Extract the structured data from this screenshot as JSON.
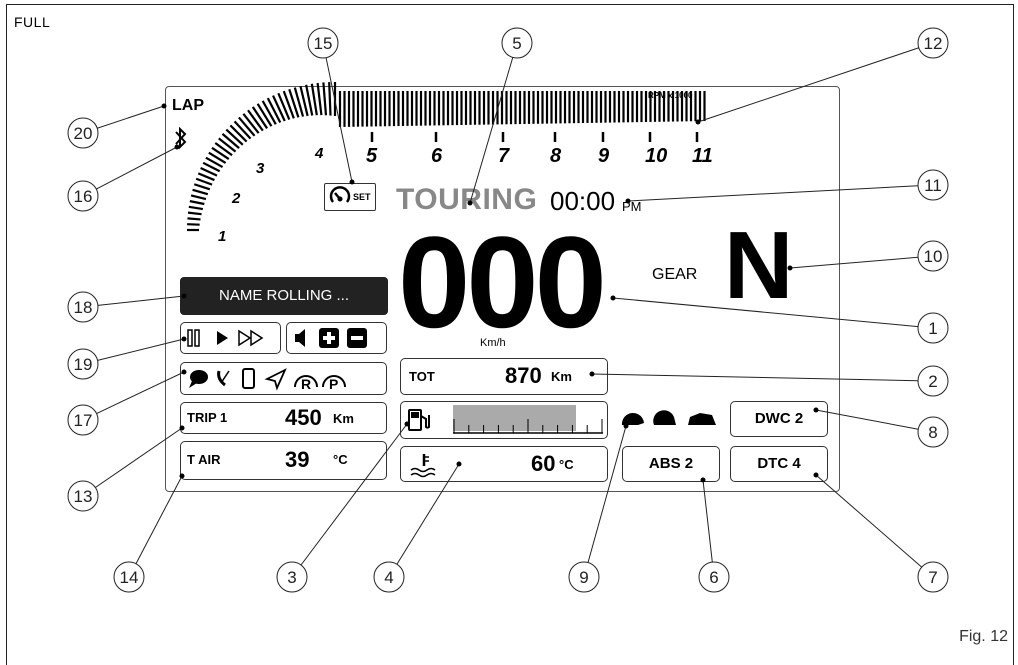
{
  "figure": {
    "corner_label": "FULL",
    "caption": "Fig. 12"
  },
  "display": {
    "lap": "LAP",
    "rpm_scale": {
      "label": "RPM x 1000",
      "ticks": [
        "1",
        "2",
        "3",
        "4",
        "5",
        "6",
        "7",
        "8",
        "9",
        "10",
        "11"
      ]
    },
    "mode": "TOURING",
    "clock": {
      "time": "00:00",
      "suffix": "PM"
    },
    "speed": {
      "value": "000",
      "unit": "Km/h"
    },
    "gear": {
      "label": "GEAR",
      "value": "N"
    },
    "name_rolling": "NAME ROLLING ...",
    "tot": {
      "label": "TOT",
      "value": "870",
      "unit": "Km"
    },
    "trip": {
      "label": "TRIP 1",
      "value": "450",
      "unit": "Km"
    },
    "tair": {
      "label": "T AIR",
      "value": "39",
      "unit": "°C"
    },
    "coolant": {
      "value": "60",
      "unit": "°C"
    },
    "fuel_level": 0.6,
    "abs": "ABS 2",
    "dwc": "DWC 2",
    "dtc": "DTC 4",
    "set_icon_label": "SET"
  },
  "callouts": [
    "1",
    "2",
    "3",
    "4",
    "5",
    "6",
    "7",
    "8",
    "9",
    "10",
    "11",
    "12",
    "13",
    "14",
    "15",
    "16",
    "17",
    "18",
    "19",
    "20"
  ],
  "icons": [
    "bluetooth-icon",
    "cruise-set-icon",
    "pause-icon",
    "play-icon",
    "fast-forward-icon",
    "volume-icon",
    "plus-icon",
    "minus-icon",
    "message-icon",
    "missed-call-icon",
    "phone-icon",
    "navigation-icon",
    "rider-helmet-icon",
    "passenger-helmet-icon",
    "fuel-pump-icon",
    "coolant-temp-icon",
    "riding-mode-icons"
  ]
}
